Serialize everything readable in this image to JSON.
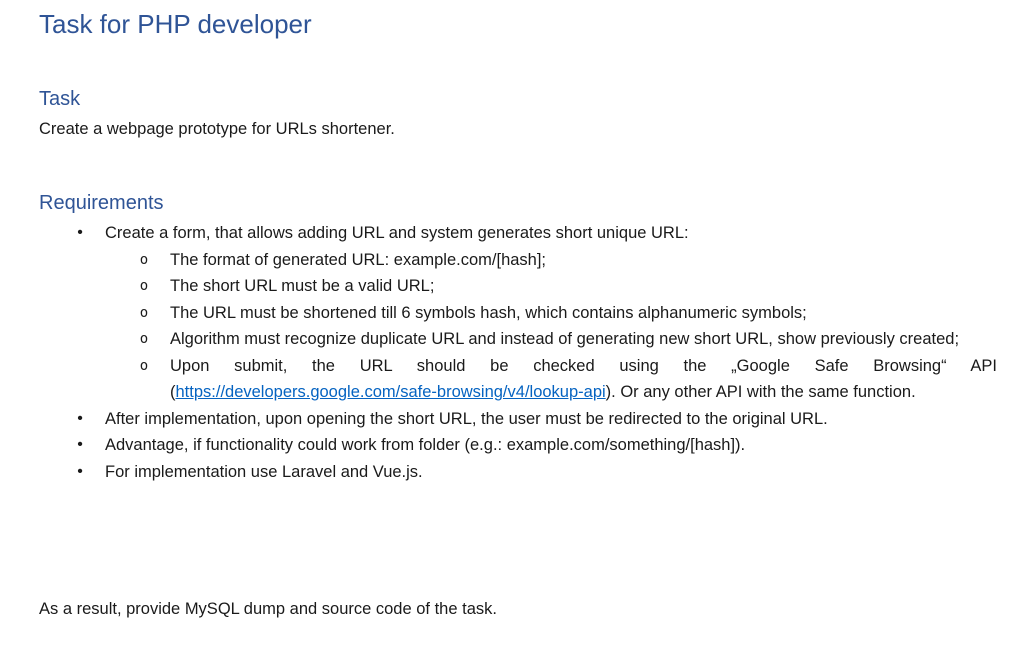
{
  "document": {
    "title": "Task for PHP developer",
    "sections": {
      "task": {
        "heading": "Task",
        "text": "Create a webpage prototype for URLs shortener."
      },
      "requirements": {
        "heading": "Requirements",
        "items": [
          {
            "text": "Create a form, that allows adding URL and system generates short unique URL:",
            "subitems": [
              "The format of generated URL: example.com/[hash];",
              "The short URL must be a valid URL;",
              "The URL must be shortened till 6 symbols hash, which contains alphanumeric symbols;",
              "Algorithm must recognize duplicate URL and instead of generating new short URL, show previously created;"
            ],
            "api_subitem": {
              "before": "Upon submit, the URL should be checked using the „Google Safe Browsing“ API (",
              "link": "https://developers.google.com/safe-browsing/v4/lookup-api",
              "after": "). Or any other API with the same function."
            }
          },
          {
            "text": "After implementation, upon opening the short URL, the user must be redirected to the original URL."
          },
          {
            "text": "Advantage, if functionality could work from folder (e.g.: example.com/something/[hash])."
          },
          {
            "text": "For implementation use Laravel and Vue.js."
          }
        ]
      },
      "result": {
        "text": "As a result, provide MySQL dump and source code of the task."
      }
    },
    "icons": {
      "bullet": "•",
      "sub_bullet": "o"
    },
    "colors": {
      "heading": "#2f5496",
      "link": "#0563c1",
      "text": "#1a1a1a"
    }
  }
}
